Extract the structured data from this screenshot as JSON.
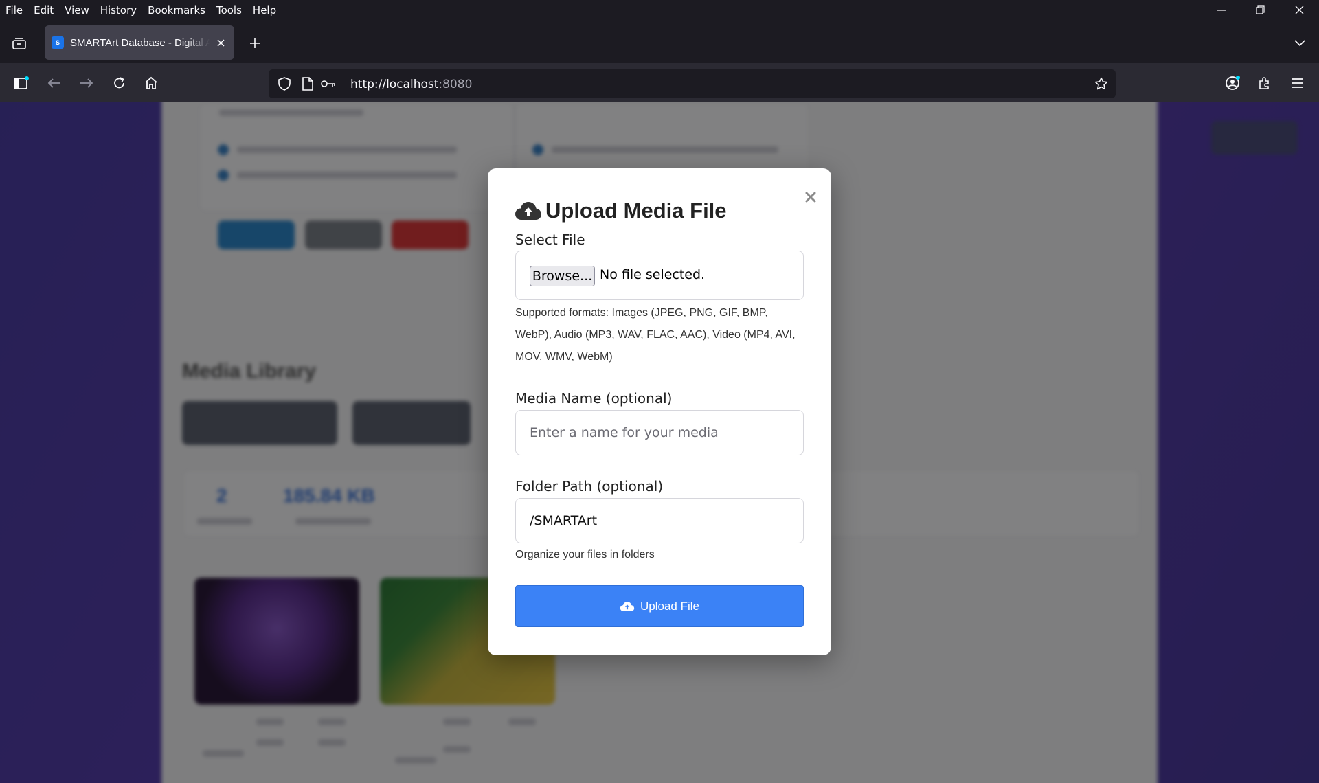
{
  "menubar": {
    "items": [
      "File",
      "Edit",
      "View",
      "History",
      "Bookmarks",
      "Tools",
      "Help"
    ]
  },
  "tab": {
    "title": "SMARTArt Database - Digital A",
    "favicon_letter": "S"
  },
  "url": {
    "scheme_host": "http://localhost",
    "port": ":8080"
  },
  "modal": {
    "title": "Upload Media File",
    "select_file_label": "Select File",
    "browse_label": "Browse...",
    "no_file_text": "No file selected.",
    "supported_formats": "Supported formats: Images (JPEG, PNG, GIF, BMP, WebP), Audio (MP3, WAV, FLAC, AAC), Video (MP4, AVI, MOV, WMV, WebM)",
    "media_name_label": "Media Name (optional)",
    "media_name_placeholder": "Enter a name for your media",
    "media_name_value": "",
    "folder_label": "Folder Path (optional)",
    "folder_value": "/SMARTArt",
    "folder_help": "Organize your files in folders",
    "upload_button": "Upload File"
  },
  "background": {
    "media_library_title": "Media Library",
    "total_files": "2",
    "storage_used": "185.84 KB"
  },
  "colors": {
    "accent": "#3b82f6",
    "page_gradient": "#4c3fa4",
    "chrome_dark": "#1c1b22",
    "navbar": "#2b2a33"
  }
}
